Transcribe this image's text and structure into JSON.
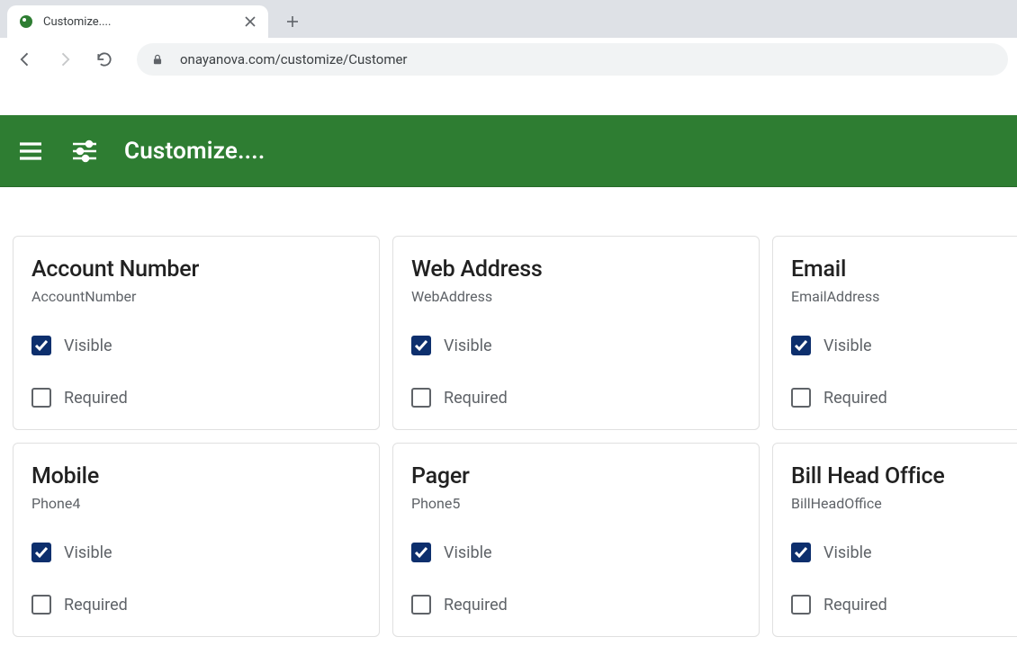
{
  "browser": {
    "tab_title": "Customize....",
    "url": "onayanova.com/customize/Customer"
  },
  "header": {
    "title": "Customize...."
  },
  "labels": {
    "visible": "Visible",
    "required": "Required"
  },
  "colors": {
    "header_bg": "#2e7d32",
    "checkbox_checked": "#0d2f6d"
  },
  "cards": [
    {
      "title": "Account Number",
      "subtitle": "AccountNumber",
      "visible": true,
      "required": false
    },
    {
      "title": "Web Address",
      "subtitle": "WebAddress",
      "visible": true,
      "required": false
    },
    {
      "title": "Email",
      "subtitle": "EmailAddress",
      "visible": true,
      "required": false
    },
    {
      "title": "Mobile",
      "subtitle": "Phone4",
      "visible": true,
      "required": false
    },
    {
      "title": "Pager",
      "subtitle": "Phone5",
      "visible": true,
      "required": false
    },
    {
      "title": "Bill Head Office",
      "subtitle": "BillHeadOffice",
      "visible": true,
      "required": false
    }
  ]
}
